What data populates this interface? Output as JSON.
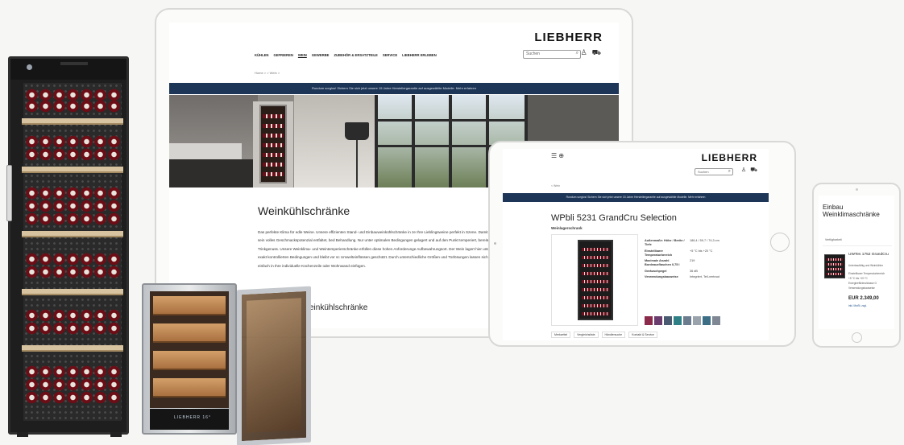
{
  "laptop": {
    "logo": "LIEBHERR",
    "nav": [
      "KÜHLEN",
      "GEFRIEREN",
      "WEIN",
      "GEWERBE",
      "ZUBEHÖR & ERSATZTEILE",
      "SERVICE",
      "LIEBHERR ERLEBEN"
    ],
    "active_nav": "WEIN",
    "search_placeholder": "Suchen",
    "breadcrumb": "Home  >  > Wein  >",
    "banner": "Rundum sorglos! Sichern Sie sich jetzt unsere 15 Jahre Herstellergarantie auf ausgewählte Modelle. Mehr erfahren",
    "title": "Weinkühlschränke",
    "paragraph": "Das perfekte Klima für edle Weine. Unsere effizienten Stand- und Einbauweinkühlschränke in ze Ihre Lieblingsweine perfekt in Szene. Damit Wein sein volles Geschmackspotenzial entfaltet, bed Behandlung. Nur unter optimalen Bedingungen gelagert und auf den Punkt temperiert, bereitet e Trinkgenuss. Unsere Weinklima- und Weintemperierschränke erfüllen diese hohen Anforderunge Aufbewahrungsort. Der Wein lagert hier unter exakt kontrollierten Bedingungen und bleibt vor sc Umwelteinflüssen geschützt. Durch unterschiedliche Größen und Türlösungen lassen sich unser einfach in Ihre individuelle Küchenzeile oder Wohnwand einfügen.",
    "subheading": "einkühlschränke"
  },
  "tablet": {
    "logo": "LIEBHERR",
    "search_placeholder": "Suchen",
    "breadcrumb": "< Wein",
    "banner": "Rundum sorglos! Sichern Sie sich jetzt unsere 15 Jahre Herstellergarantie auf ausgewählte Modelle. Mehr erfahren",
    "product_title": "WPbli 5231 GrandCru Selection",
    "product_subtitle": "Weinlagerschrank",
    "specs": [
      {
        "key": "Außenmaße: Höhe / Breite / Tiefe",
        "value": "186,4 / 59,7 / 74,3 cm"
      },
      {
        "key": "Einstellbarer Temperaturbereich",
        "value": "+5 °C bis +20 °C"
      },
      {
        "key": "Maximale Anzahl Bordeauxflaschen 0,75 l",
        "value": "219"
      },
      {
        "key": "Geräuschpegel",
        "value": "36 dB"
      },
      {
        "key": "Verwendungsbauweise",
        "value": "Integriert, Teil-vertraut"
      }
    ],
    "swatch_colors": [
      "#8b2a4a",
      "#6a3d6e",
      "#4a5a70",
      "#2f7f86",
      "#6b7c8e",
      "#9aa2ab",
      "#3c6f86",
      "#7e8793"
    ],
    "tabs": [
      "Merkzettel",
      "Vergleichsliste",
      "Händlersuche",
      "Kontakt & Service"
    ]
  },
  "phone": {
    "title": "Einbau Weinklimaschränke",
    "filter": "Verfügbarkeit",
    "product_name": "UWTes 1752 GrandCru",
    "lines": [
      "Unterbaufähig und Weinkühler",
      "Einstellbarer Temperaturbereich",
      "+5 °C bis +20 °C",
      "Energieeffizienzklasse G",
      "Verwendungsbauweise"
    ],
    "price": "EUR 2.349,00",
    "link": "inkl. MwSt. zzgl."
  },
  "humidor": {
    "display": "LIEBHERR 16°"
  }
}
